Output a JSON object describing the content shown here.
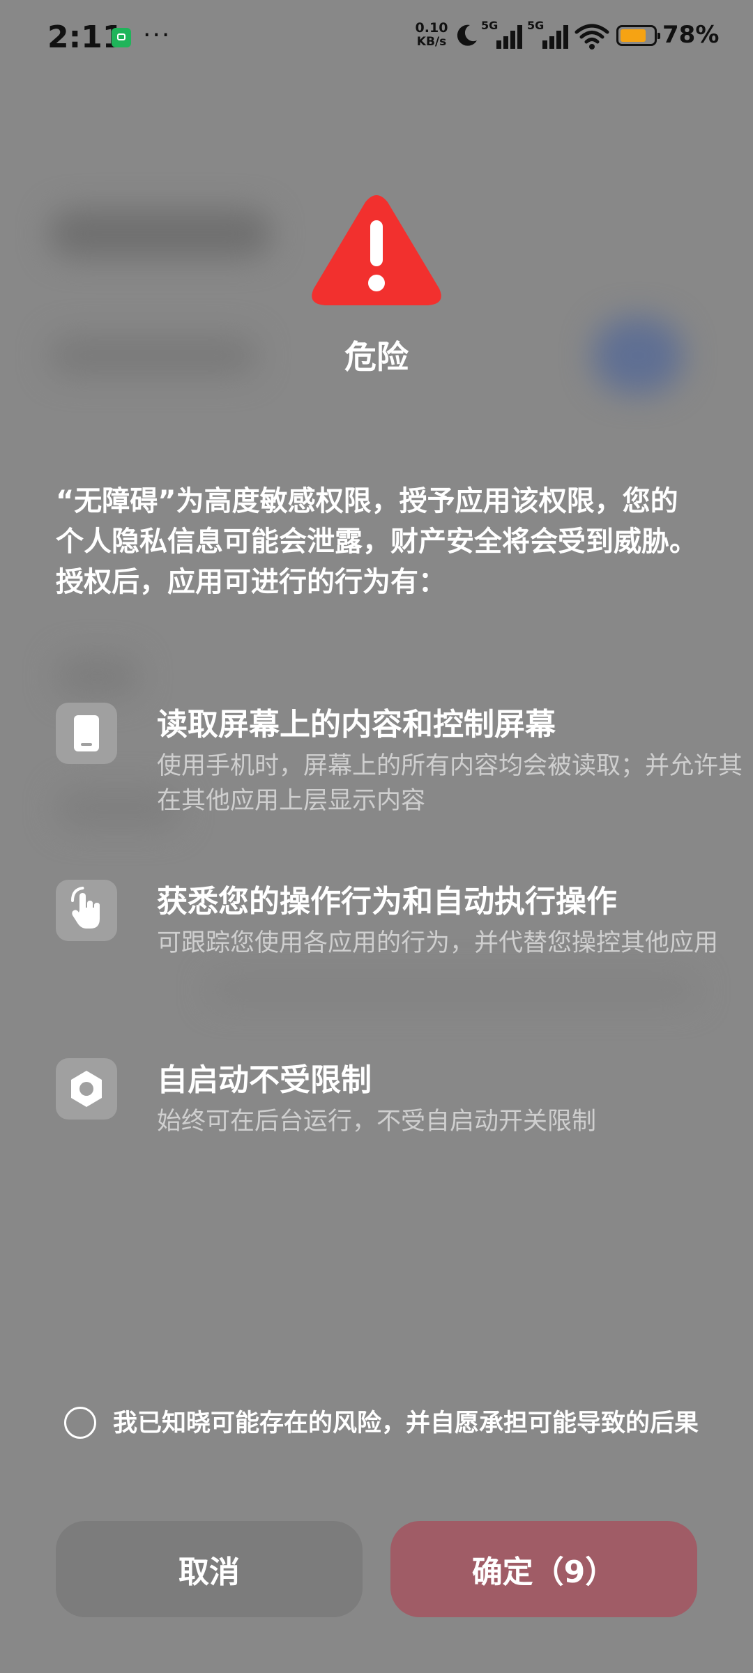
{
  "status_bar": {
    "time": "2:11",
    "net_speed_value": "0.10",
    "net_speed_unit": "KB/s",
    "signal_1_label": "5G",
    "signal_2_label": "5G",
    "battery_percent": "78%",
    "battery_level": 0.78,
    "battery_color": "#f6a313"
  },
  "dialog": {
    "title": "危险",
    "intro": "“无障碍”为高度敏感权限，授予应用该权限，您的个人隐私信息可能会泄露，财产安全将会受到威胁。授权后，应用可进行的行为有：",
    "permissions": [
      {
        "icon": "phone-screen-icon",
        "title": "读取屏幕上的内容和控制屏幕",
        "desc": "使用手机时，屏幕上的所有内容均会被读取；并允许其在其他应用上层显示内容"
      },
      {
        "icon": "touch-hand-icon",
        "title": "获悉您的操作行为和自动执行操作",
        "desc": "可跟踪您使用各应用的行为，并代替您操控其他应用"
      },
      {
        "icon": "hexagon-nut-icon",
        "title": "自启动不受限制",
        "desc": "始终可在后台运行，不受自启动开关限制"
      }
    ],
    "consent_text": "我已知晓可能存在的风险，并自愿承担可能导致的后果",
    "consent_checked": false,
    "cancel_label": "取消",
    "confirm_label": "确定（9）",
    "warning_color": "#f2302e",
    "confirm_color": "#a05c66"
  }
}
